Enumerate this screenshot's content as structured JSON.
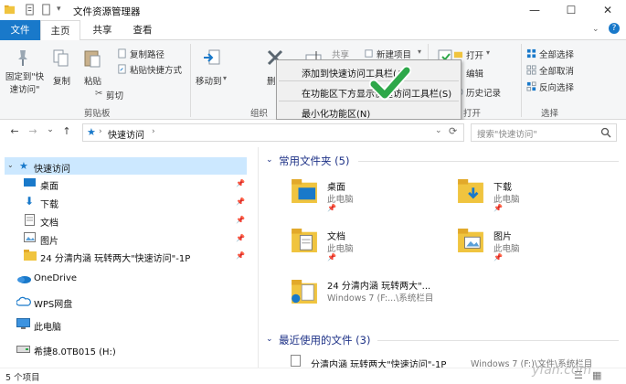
{
  "window": {
    "title": "文件资源管理器",
    "minimize": "—",
    "maximize": "☐",
    "close": "✕"
  },
  "tabs": {
    "file": "文件",
    "home": "主页",
    "share": "共享",
    "view": "查看"
  },
  "ribbon": {
    "pin_line1": "固定到\"快",
    "pin_line2": "速访问\"",
    "copy": "复制",
    "paste": "粘贴",
    "copy_path": "复制路径",
    "paste_shortcut": "粘贴快捷方式",
    "cut": "剪切",
    "move_to": "移动到",
    "delete_partial": "删",
    "new_item": "新建项目",
    "open": "打开",
    "edit": "编辑",
    "history": "历史记录",
    "select_all": "全部选择",
    "select_none": "全部取消",
    "invert_selection": "反向选择",
    "groups": {
      "clipboard": "剪贴板",
      "organize": "组织",
      "open": "打开",
      "select": "选择"
    }
  },
  "context_menu": {
    "items": [
      "添加到快速访问工具栏(A)",
      "在功能区下方显示快速访问工具栏(S)",
      "最小化功能区(N)"
    ]
  },
  "navbar": {
    "back": "←",
    "forward": "→",
    "dropdown": "⌄",
    "up": "↑",
    "path": "快速访问",
    "path_sep": "›",
    "refresh": "⟳",
    "search_placeholder": "搜索\"快速访问\""
  },
  "sidebar": {
    "quick_access": "快速访问",
    "items": [
      "桌面",
      "下载",
      "文档",
      "图片",
      "24 分清内涵  玩转两大\"快速访问\"-1P"
    ],
    "onedrive": "OneDrive",
    "wps": "WPS网盘",
    "pc": "此电脑",
    "drive": "希捷8.0TB015 (H:)",
    "pin": "📌"
  },
  "frequent": {
    "heading": "常用文件夹 (5)",
    "folders": [
      {
        "name": "桌面",
        "sub": "此电脑"
      },
      {
        "name": "下载",
        "sub": "此电脑"
      },
      {
        "name": "文档",
        "sub": "此电脑"
      },
      {
        "name": "图片",
        "sub": "此电脑"
      },
      {
        "name": "24 分清内涵  玩转两大\"...",
        "sub": "Windows 7 (F:...\\系统栏目"
      }
    ]
  },
  "recent": {
    "heading": "最近使用的文件 (3)",
    "first_file": "分清内涵  玩转两大\"快速访问\"-1P",
    "first_path": "Windows 7 (F:)\\文件\\系统栏目"
  },
  "status": {
    "count": "5 个项目"
  },
  "watermark": "yfan.com",
  "colors": {
    "accent": "#1979ca",
    "selection": "#cce8ff",
    "heading": "#1e3287",
    "check": "#2ea84a"
  }
}
